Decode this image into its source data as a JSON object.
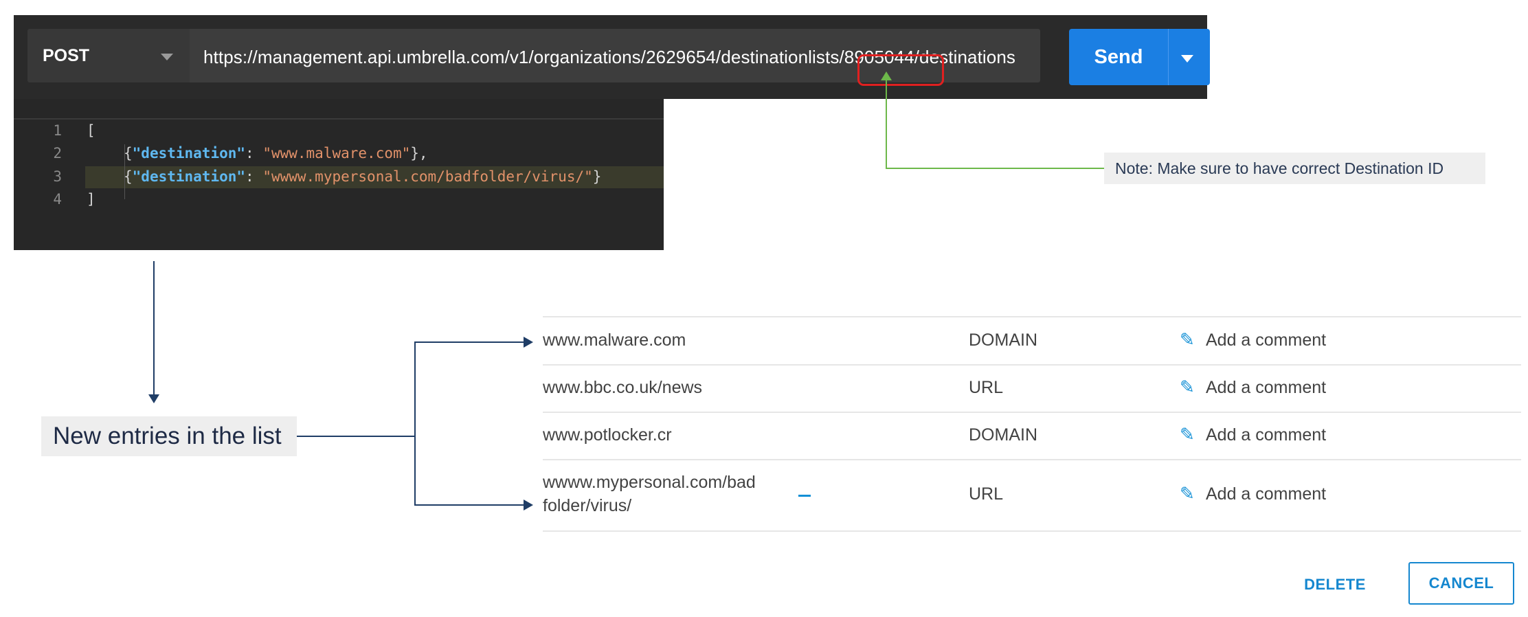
{
  "request": {
    "method": "POST",
    "url_prefix": "https://management.api.umbrella.com/v1/organizations/2629654/destinationlists",
    "url_id_segment": "/8905044/",
    "url_suffix": "destinations",
    "send_label": "Send"
  },
  "editor": {
    "line_numbers": [
      "1",
      "2",
      "3",
      "4"
    ],
    "line1": "[",
    "line2_open": "{",
    "line2_key": "\"destination\"",
    "line2_colon": ": ",
    "line2_value": "\"www.malware.com\"",
    "line2_close": "},",
    "line3_open": "{",
    "line3_key": "\"destination\"",
    "line3_colon": ": ",
    "line3_value": "\"wwww.mypersonal.com/badfolder/virus/\"",
    "line3_close": "}",
    "line4": "]"
  },
  "note": "Note: Make sure to have correct Destination ID",
  "label": "New entries in the list",
  "table": {
    "rows": [
      {
        "destination": "www.malware.com",
        "type": "DOMAIN",
        "comment": "Add a comment"
      },
      {
        "destination": "www.bbc.co.uk/news",
        "type": "URL",
        "comment": "Add a comment"
      },
      {
        "destination": "www.potlocker.cr",
        "type": "DOMAIN",
        "comment": "Add a comment"
      },
      {
        "destination_line1": "wwww.mypersonal.com/bad",
        "destination_line2": "folder/virus/",
        "type": "URL",
        "comment": "Add a comment"
      }
    ]
  },
  "actions": {
    "delete_label": "DELETE",
    "cancel_label": "CANCEL"
  },
  "colors": {
    "send_blue": "#1b7fe3",
    "highlight_red": "#e02020",
    "accent_blue": "#1587cf",
    "green_arrow": "#6db84a",
    "navy_arrow": "#1f3d66"
  }
}
